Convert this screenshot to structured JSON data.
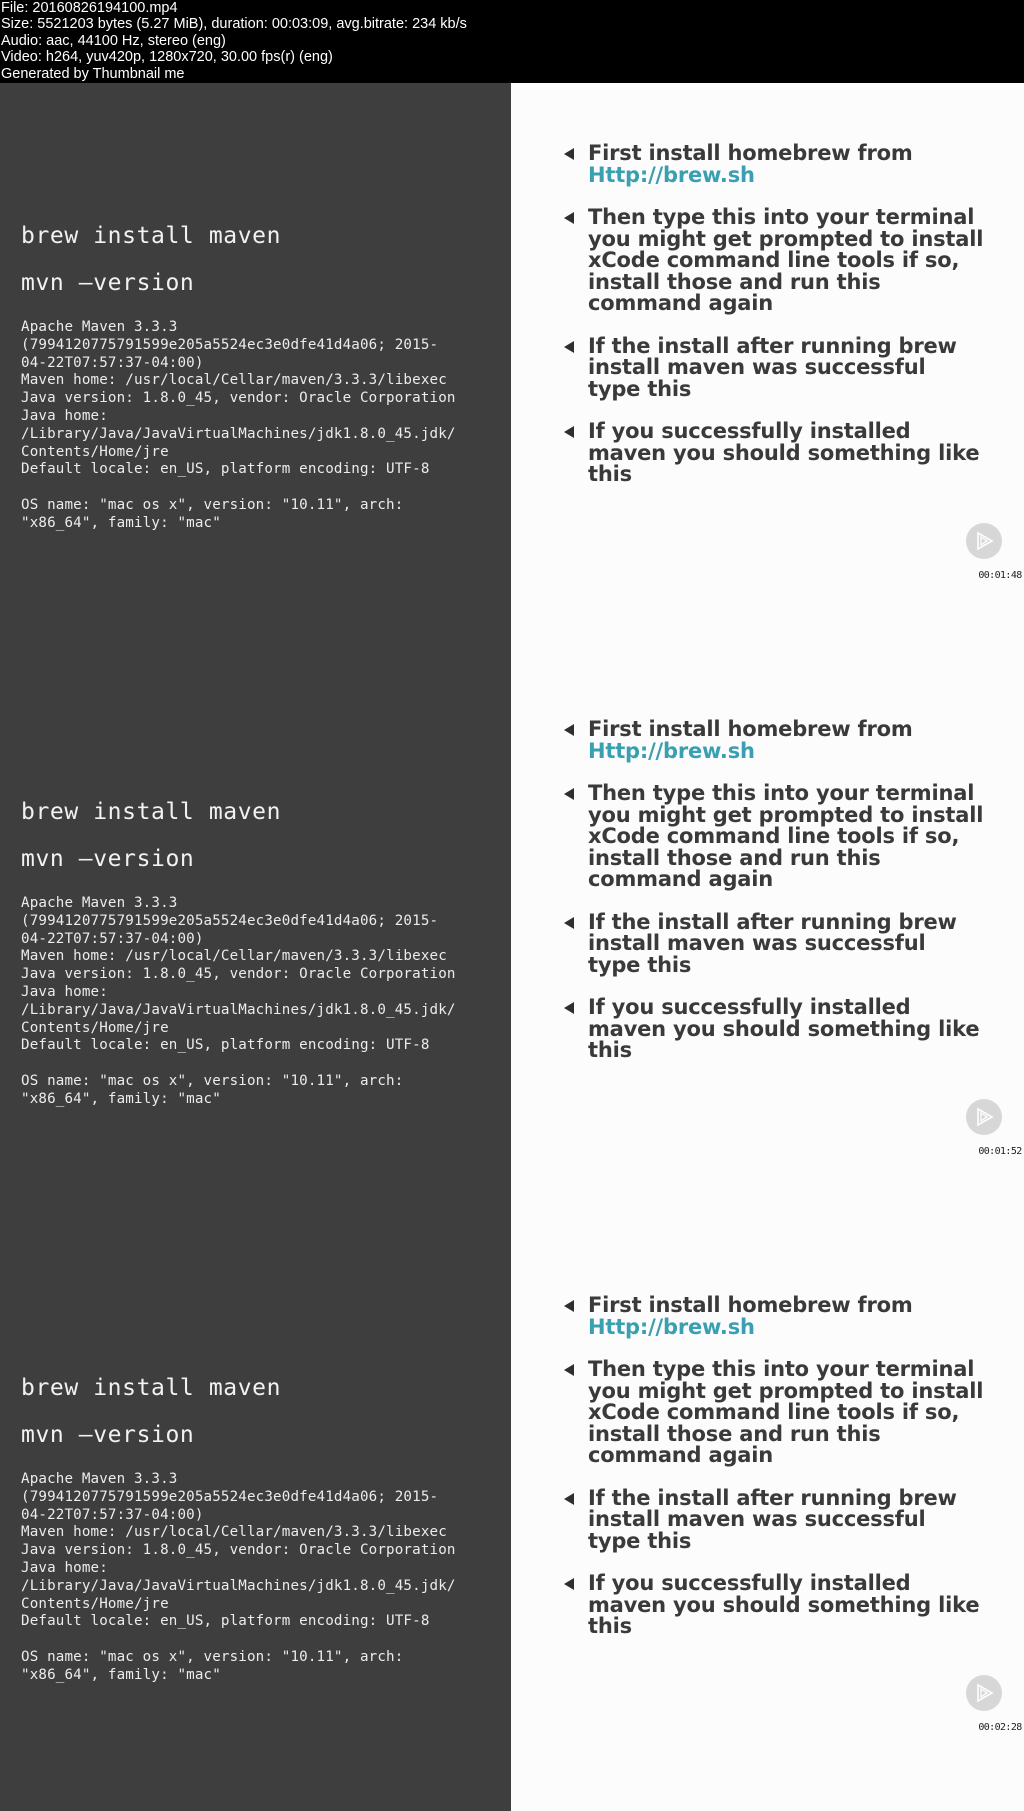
{
  "header": {
    "lines": [
      "File: 20160826194100.mp4",
      "Size: 5521203 bytes (5.27 MiB), duration: 00:03:09, avg.bitrate: 234 kb/s",
      "Audio: aac, 44100 Hz, stereo (eng)",
      "Video: h264, yuv420p, 1280x720, 30.00 fps(r) (eng)",
      "Generated by Thumbnail me"
    ]
  },
  "slide": {
    "commands": [
      "brew install maven",
      "mvn –version"
    ],
    "output_lines": [
      "Apache Maven 3.3.3",
      "(7994120775791599e205a5524ec3e0dfe41d4a06; 2015-",
      "04-22T07:57:37-04:00)",
      "Maven home: /usr/local/Cellar/maven/3.3.3/libexec",
      "Java version: 1.8.0_45, vendor: Oracle Corporation",
      "Java home:",
      "/Library/Java/JavaVirtualMachines/jdk1.8.0_45.jdk/",
      "Contents/Home/jre",
      "Default locale: en_US, platform encoding: UTF-8",
      "",
      "OS name: \"mac os x\", version: \"10.11\", arch:",
      "\"x86_64\", family: \"mac\""
    ],
    "bullets": [
      {
        "text": "First install homebrew from",
        "link": "Http://brew.sh"
      },
      {
        "text": "Then type this into your terminal you might get prompted to install xCode command line tools if so, install those and run this command again"
      },
      {
        "text": "If the install after running brew install maven was successful type this"
      },
      {
        "text": "If you successfully installed maven you should something like this"
      }
    ],
    "bullet_icon": "triangle-left-icon",
    "link_color": "#3aa0b1"
  },
  "frames": [
    {
      "timestamp": "00:01:48"
    },
    {
      "timestamp": "00:01:52"
    },
    {
      "timestamp": "00:02:28"
    }
  ]
}
